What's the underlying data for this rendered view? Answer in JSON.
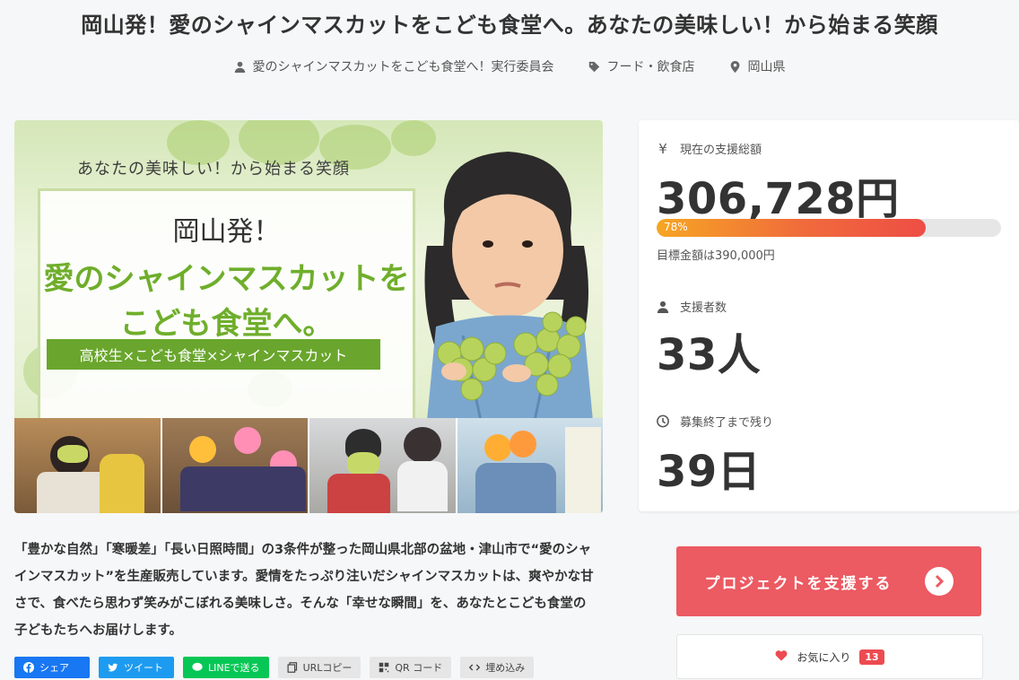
{
  "title": "岡山発！愛のシャインマスカットをこども食堂へ。あなたの美味しい！から始まる笑顔",
  "meta": {
    "owner": "愛のシャインマスカットをこども食堂へ！実行委員会",
    "category": "フード・飲食店",
    "location": "岡山県"
  },
  "hero": {
    "catch": "あなたの美味しい！から始まる笑顔",
    "line1": "岡山発！",
    "line2": "愛のシャインマスカットを",
    "line3": "こども食堂へ。",
    "ribbon": "高校生×こども食堂×シャインマスカット"
  },
  "stats": {
    "amount_label": "現在の支援総額",
    "amount": "306,728円",
    "progress_pct": 78,
    "progress_text": "78%",
    "goal": "目標金額は390,000円",
    "supporters_label": "支援者数",
    "supporters": "33人",
    "remaining_label": "募集終了まで残り",
    "remaining": "39日"
  },
  "description": "「豊かな自然」「寒暖差」「長い日照時間」の3条件が整った岡山県北部の盆地・津山市で“愛のシャインマスカット”を生産販売しています。愛情をたっぷり注いだシャインマスカットは、爽やかな甘さで、食べたら思わず笑みがこぼれる美味しさ。そんな「幸せな瞬間」を、あなたとこども食堂の子どもたちへお届けします。",
  "support_button": "プロジェクトを支援する",
  "favorite": {
    "label": "お気に入り",
    "count": "13"
  },
  "share": {
    "facebook": "シェア",
    "twitter": "ツイート",
    "line": "LINEで送る",
    "url": "URLコピー",
    "qr": "QR コード",
    "embed": "埋め込み"
  },
  "colors": {
    "accent": "#ec5a62",
    "grape_green": "#6fae2b",
    "progress_start": "#f6a623",
    "progress_end": "#ee4e45"
  }
}
